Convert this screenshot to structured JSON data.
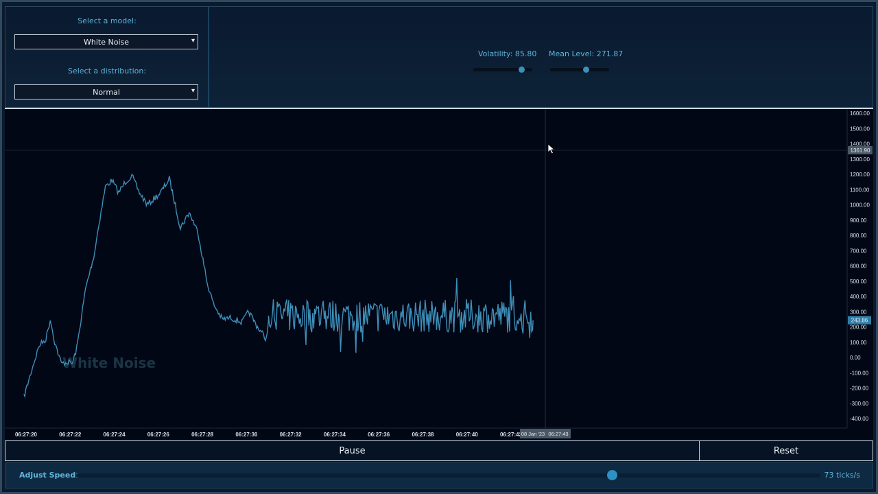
{
  "controls": {
    "model_label": "Select a model:",
    "model_value": "White Noise",
    "distribution_label": "Select a distribution:",
    "distribution_value": "Normal",
    "volatility_label": "Volatility: 85.80",
    "volatility_value": 85.8,
    "mean_label": "Mean Level: 271.87",
    "mean_value": 271.87
  },
  "chart": {
    "watermark": "White Noise",
    "crosshair_date": "08 Jan '23",
    "crosshair_time": "06:27:43",
    "crosshair_price": "1361.90",
    "last_price": "243.86",
    "y_ticks": [
      "1600.00",
      "1500.00",
      "1400.00",
      "1300.00",
      "1200.00",
      "1100.00",
      "1000.00",
      "900.00",
      "800.00",
      "700.00",
      "600.00",
      "500.00",
      "400.00",
      "300.00",
      "200.00",
      "100.00",
      "0.00",
      "-100.00",
      "-200.00",
      "-300.00",
      "-400.00"
    ],
    "x_ticks": [
      "06:27:20",
      "06:27:22",
      "06:27:24",
      "06:27:26",
      "06:27:28",
      "06:27:30",
      "06:27:32",
      "06:27:34",
      "06:27:36",
      "06:27:38",
      "06:27:40",
      "06:27:42"
    ]
  },
  "chart_data": {
    "type": "line",
    "ylim": [
      -400,
      1600
    ],
    "x_range": [
      "06:27:19.9",
      "06:28:00.5"
    ],
    "series": [
      {
        "color": "#3f8fb8",
        "points": [
          [
            "06:27:19.9",
            -260
          ],
          [
            "06:27:20.3",
            -60
          ],
          [
            "06:27:20.6",
            80
          ],
          [
            "06:27:20.9",
            120
          ],
          [
            "06:27:21.1",
            250
          ],
          [
            "06:27:21.3",
            100
          ],
          [
            "06:27:21.6",
            -40
          ],
          [
            "06:27:21.9",
            -30
          ],
          [
            "06:27:22.1",
            -40
          ],
          [
            "06:27:22.3",
            60
          ],
          [
            "06:27:22.7",
            450
          ],
          [
            "06:27:23.1",
            680
          ],
          [
            "06:27:23.3",
            870
          ],
          [
            "06:27:23.6",
            1120
          ],
          [
            "06:27:23.9",
            1160
          ],
          [
            "06:27:24.2",
            1080
          ],
          [
            "06:27:24.5",
            1150
          ],
          [
            "06:27:24.8",
            1190
          ],
          [
            "06:27:25.1",
            1090
          ],
          [
            "06:27:25.5",
            1000
          ],
          [
            "06:27:25.8",
            1040
          ],
          [
            "06:27:26.1",
            1080
          ],
          [
            "06:27:26.5",
            1170
          ],
          [
            "06:27:27.0",
            850
          ],
          [
            "06:27:27.4",
            950
          ],
          [
            "06:27:27.8",
            820
          ],
          [
            "06:27:28.2",
            500
          ],
          [
            "06:27:28.5",
            350
          ],
          [
            "06:27:28.9",
            250
          ],
          [
            "06:27:29.3",
            260
          ],
          [
            "06:27:29.8",
            230
          ],
          [
            "06:27:30.1",
            300
          ],
          [
            "06:27:30.5",
            200
          ],
          [
            "06:27:30.9",
            120
          ],
          [
            "06:27:31.0",
            250
          ]
        ],
        "noise_segment": {
          "from": "06:27:31.0",
          "to": "06:27:43.0",
          "mean": 271.87,
          "min": 30,
          "max": 530
        }
      }
    ]
  },
  "buttons": {
    "pause": "Pause",
    "reset": "Reset"
  },
  "speed": {
    "label": "Adjust Speed:",
    "value_text": "73 ticks/s",
    "value": 73,
    "fraction": 0.72
  }
}
